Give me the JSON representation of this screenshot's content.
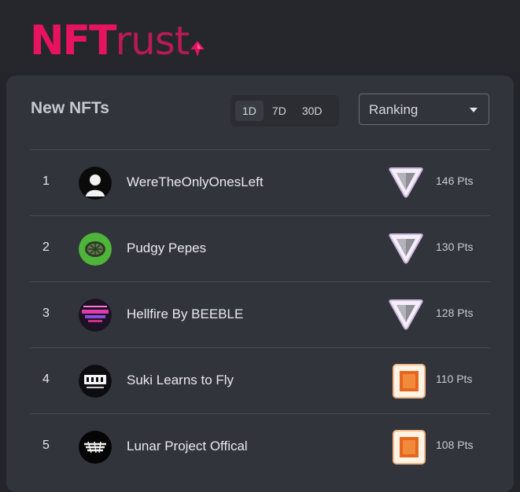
{
  "header": {
    "logo_primary": "NFT",
    "logo_secondary": "rust",
    "logo_icon": "diamond-arrow-icon"
  },
  "panel": {
    "title": "New NFTs",
    "periods": [
      {
        "label": "1D",
        "active": true
      },
      {
        "label": "7D",
        "active": false
      },
      {
        "label": "30D",
        "active": false
      }
    ],
    "sort_select": {
      "value": "Ranking",
      "icon": "chevron-down-icon"
    }
  },
  "rows": [
    {
      "rank": "1",
      "name": "WereTheOnlyOnesLeft",
      "badge": "triangle-shield-icon",
      "points": "146 Pts"
    },
    {
      "rank": "2",
      "name": "Pudgy Pepes",
      "badge": "triangle-shield-icon",
      "points": "130 Pts"
    },
    {
      "rank": "3",
      "name": "Hellfire By BEEBLE",
      "badge": "triangle-shield-icon",
      "points": "128 Pts"
    },
    {
      "rank": "4",
      "name": "Suki Learns to Fly",
      "badge": "orange-square-icon",
      "points": "110 Pts"
    },
    {
      "rank": "5",
      "name": "Lunar Project Offical",
      "badge": "orange-square-icon",
      "points": "108 Pts"
    }
  ],
  "colors": {
    "brand_pink": "#e8135f",
    "background": "#23252b",
    "panel": "#32343b",
    "badge_orange": "#e8772a",
    "badge_silver": "#d6cfe0"
  }
}
